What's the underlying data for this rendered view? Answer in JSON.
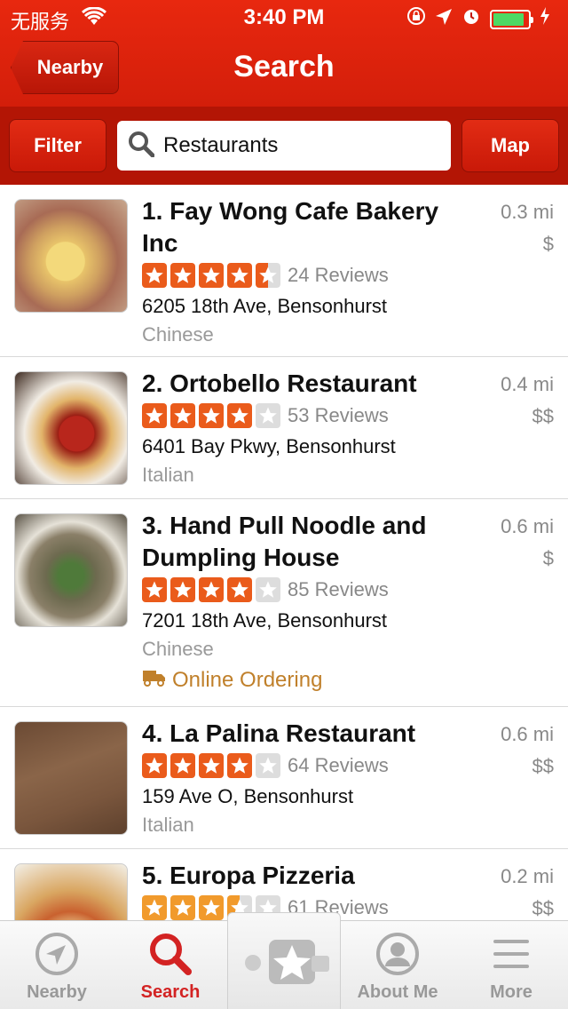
{
  "status_bar": {
    "carrier": "无服务",
    "time": "3:40 PM"
  },
  "nav": {
    "back_label": "Nearby",
    "title": "Search"
  },
  "search": {
    "filter_label": "Filter",
    "query": "Restaurants",
    "map_label": "Map"
  },
  "results": [
    {
      "name": "1. Fay Wong Cafe Bakery Inc",
      "distance": "0.3 mi",
      "price": "$",
      "rating": 4.5,
      "reviews": "24 Reviews",
      "address": "6205 18th Ave, Bensonhurst",
      "category": "Chinese"
    },
    {
      "name": "2. Ortobello Restaurant",
      "distance": "0.4 mi",
      "price": "$$",
      "rating": 4,
      "reviews": "53 Reviews",
      "address": "6401 Bay Pkwy, Bensonhurst",
      "category": "Italian"
    },
    {
      "name": "3. Hand Pull Noodle and Dumpling House",
      "distance": "0.6 mi",
      "price": "$",
      "rating": 4,
      "reviews": "85 Reviews",
      "address": "7201 18th Ave, Bensonhurst",
      "category": "Chinese",
      "extra": "Online Ordering"
    },
    {
      "name": "4. La Palina Restaurant",
      "distance": "0.6 mi",
      "price": "$$",
      "rating": 4,
      "reviews": "64 Reviews",
      "address": "159 Ave O, Bensonhurst",
      "category": "Italian"
    },
    {
      "name": "5. Europa Pizzeria",
      "distance": "0.2 mi",
      "price": "$$",
      "rating": 3.5,
      "reviews": "61 Reviews"
    }
  ],
  "tabs": {
    "nearby": "Nearby",
    "search": "Search",
    "about_me": "About Me",
    "more": "More"
  },
  "colors": {
    "brand_red": "#d32323",
    "star_orange": "#ea5b1b",
    "order_gold": "#c0802b"
  }
}
